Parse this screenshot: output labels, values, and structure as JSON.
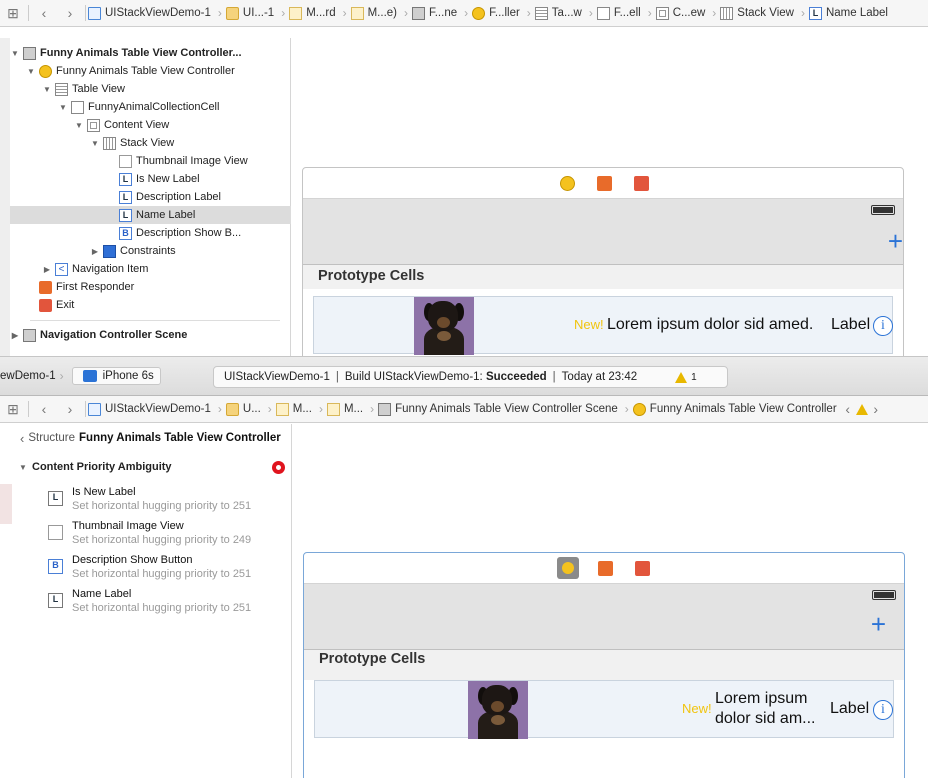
{
  "top_jumpbar": {
    "crumbs": [
      "UIStackViewDemo-1",
      "UI...-1",
      "M...rd",
      "M...e)",
      "F...ne",
      "F...ller",
      "Ta...w",
      "F...ell",
      "C...ew",
      "Stack View",
      "Name Label"
    ]
  },
  "outline": {
    "scene_title": "Funny Animals Table View Controller...",
    "items": [
      {
        "label": "Funny Animals Table View Controller"
      },
      {
        "label": "Table View"
      },
      {
        "label": "FunnyAnimalCollectionCell"
      },
      {
        "label": "Content View"
      },
      {
        "label": "Stack View"
      },
      {
        "label": "Thumbnail Image View"
      },
      {
        "label": "Is New Label"
      },
      {
        "label": "Description Label"
      },
      {
        "label": "Name Label"
      },
      {
        "label": "Description Show B..."
      },
      {
        "label": "Constraints"
      },
      {
        "label": "Navigation Item"
      },
      {
        "label": "First Responder"
      },
      {
        "label": "Exit"
      }
    ],
    "nav_scene_title": "Navigation Controller Scene"
  },
  "top_canvas": {
    "prototype_header": "Prototype Cells",
    "new_label": "New!",
    "description": "Lorem ipsum dolor sid amed.",
    "name_label": "Label",
    "info_glyph": "i"
  },
  "mid_bar": {
    "scheme": "ewDemo-1",
    "device": "iPhone 6s",
    "status_project": "UIStackViewDemo-1",
    "status_build": "Build UIStackViewDemo-1:",
    "status_result": "Succeeded",
    "status_time": "Today at 23:42",
    "warning_count": "1"
  },
  "bottom_jumpbar": {
    "crumbs": [
      "UIStackViewDemo-1",
      "U...",
      "M...",
      "M...",
      "Funny Animals Table View Controller Scene",
      "Funny Animals Table View Controller"
    ]
  },
  "issues": {
    "structure_label": "Structure",
    "structure_title": "Funny Animals Table View Controller",
    "header": "Content Priority Ambiguity",
    "items": [
      {
        "title": "Is New Label",
        "detail": "Set horizontal hugging priority to 251"
      },
      {
        "title": "Thumbnail Image View",
        "detail": "Set horizontal hugging priority to 249"
      },
      {
        "title": "Description Show Button",
        "detail": "Set horizontal hugging priority to 251"
      },
      {
        "title": "Name Label",
        "detail": "Set horizontal hugging priority to 251"
      }
    ]
  },
  "bottom_canvas": {
    "prototype_header": "Prototype Cells",
    "new_label": "New!",
    "description_line1": "Lorem ipsum",
    "description_line2": "dolor sid am...",
    "name_label": "Label",
    "info_glyph": "i"
  },
  "icons": {
    "grid": "grid-icon",
    "back": "chevron-left-icon",
    "forward": "chevron-right-icon",
    "label_glyph": "L",
    "button_glyph": "B",
    "nav_glyph": "<"
  },
  "colors": {
    "accent": "#2b73d6",
    "new_label": "#f1c40f",
    "error": "#e0141e",
    "warning": "#e8b800"
  }
}
